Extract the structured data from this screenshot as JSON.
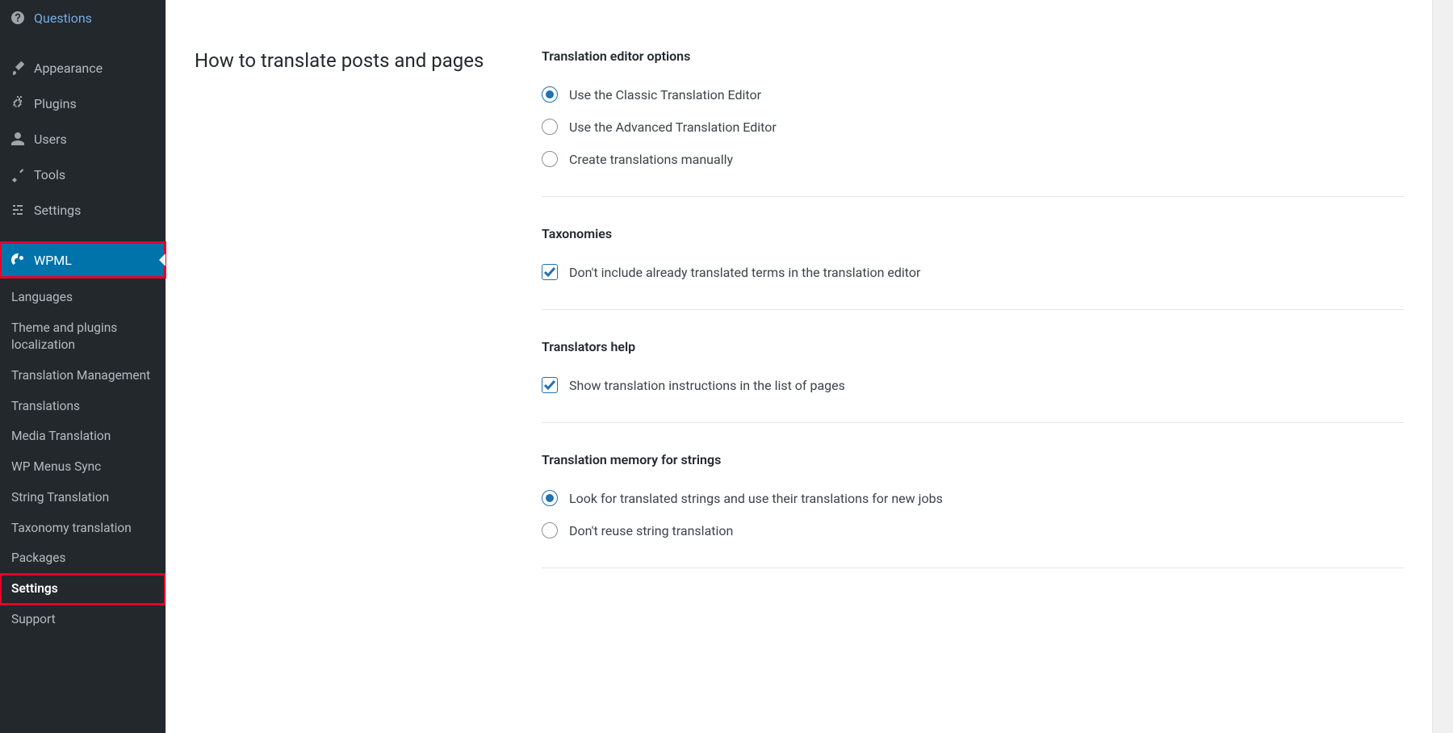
{
  "sidebar": {
    "items": [
      {
        "label": "Questions",
        "icon": "help"
      },
      {
        "label": "Appearance",
        "icon": "brush"
      },
      {
        "label": "Plugins",
        "icon": "plug"
      },
      {
        "label": "Users",
        "icon": "user"
      },
      {
        "label": "Tools",
        "icon": "wrench"
      },
      {
        "label": "Settings",
        "icon": "sliders"
      },
      {
        "label": "WPML",
        "icon": "wpml"
      }
    ],
    "submenu": [
      {
        "label": "Languages"
      },
      {
        "label": "Theme and plugins localization"
      },
      {
        "label": "Translation Management"
      },
      {
        "label": "Translations"
      },
      {
        "label": "Media Translation"
      },
      {
        "label": "WP Menus Sync"
      },
      {
        "label": "String Translation"
      },
      {
        "label": "Taxonomy translation"
      },
      {
        "label": "Packages"
      },
      {
        "label": "Settings"
      },
      {
        "label": "Support"
      }
    ]
  },
  "main": {
    "heading": "How to translate posts and pages",
    "sections": {
      "editor": {
        "title": "Translation editor options",
        "options": [
          "Use the Classic Translation Editor",
          "Use the Advanced Translation Editor",
          "Create translations manually"
        ]
      },
      "taxonomies": {
        "title": "Taxonomies",
        "option": "Don't include already translated terms in the translation editor"
      },
      "help": {
        "title": "Translators help",
        "option": "Show translation instructions in the list of pages"
      },
      "memory": {
        "title": "Translation memory for strings",
        "options": [
          "Look for translated strings and use their translations for new jobs",
          "Don't reuse string translation"
        ]
      }
    }
  }
}
